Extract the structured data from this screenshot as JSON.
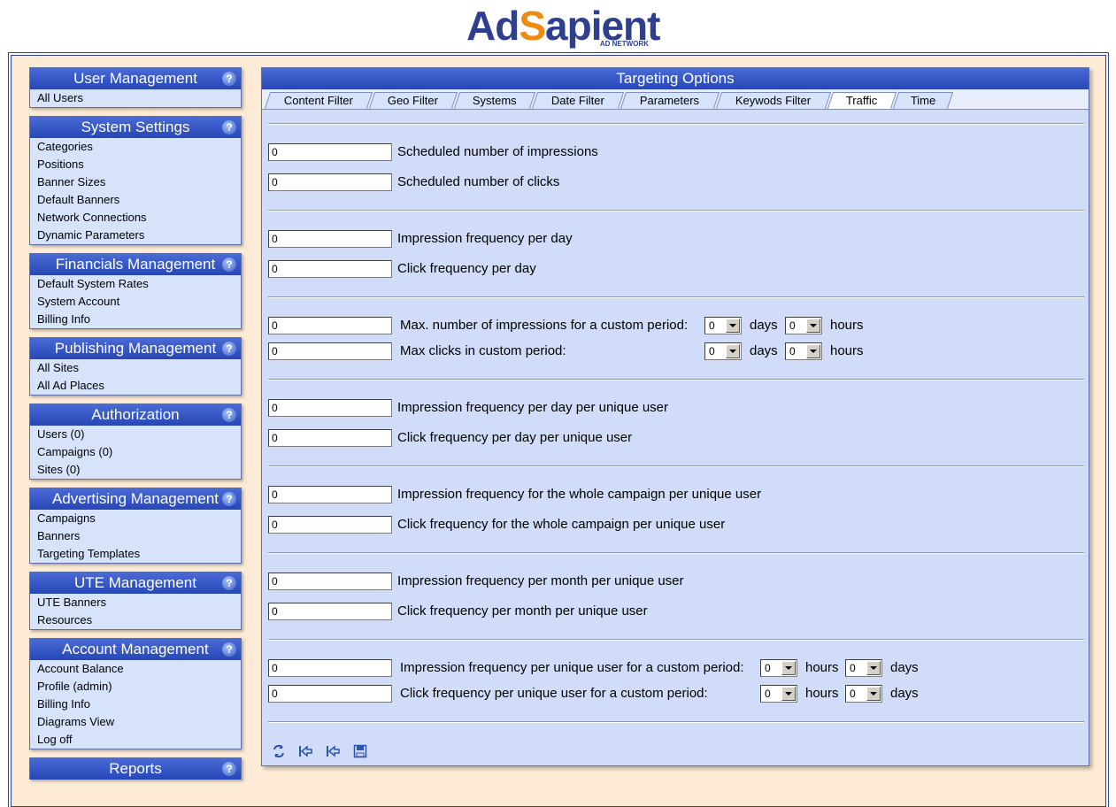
{
  "logo": {
    "part1": "Ad",
    "part2": "S",
    "part3": "apient",
    "tagline": "AD NETWORK"
  },
  "sidebar": {
    "sections": [
      {
        "title": "User Management",
        "items": [
          "All Users"
        ]
      },
      {
        "title": "System Settings",
        "items": [
          "Categories",
          "Positions",
          "Banner Sizes",
          "Default Banners",
          "Network Connections",
          "Dynamic Parameters"
        ]
      },
      {
        "title": "Financials Management",
        "items": [
          "Default System Rates",
          "System Account",
          "Billing Info"
        ]
      },
      {
        "title": "Publishing Management",
        "items": [
          "All Sites",
          "All Ad Places"
        ]
      },
      {
        "title": "Authorization",
        "items": [
          "Users (0)",
          "Campaigns (0)",
          "Sites (0)"
        ]
      },
      {
        "title": "Advertising Management",
        "items": [
          "Campaigns",
          "Banners",
          "Targeting Templates"
        ]
      },
      {
        "title": "UTE Management",
        "items": [
          "UTE Banners",
          "Resources"
        ]
      },
      {
        "title": "Account Management",
        "items": [
          "Account Balance",
          "Profile (admin)",
          "Billing Info",
          "Diagrams View",
          "Log off"
        ]
      },
      {
        "title": "Reports",
        "items": []
      }
    ],
    "help_glyph": "?"
  },
  "main": {
    "title": "Targeting Options",
    "tabs": [
      "Content Filter",
      "Geo Filter",
      "Systems",
      "Date Filter",
      "Parameters",
      "Keywods Filter",
      "Traffic",
      "Time"
    ],
    "active_tab": "Traffic",
    "fields": {
      "sched_impr": {
        "value": "0",
        "label": "Scheduled number of impressions"
      },
      "sched_clicks": {
        "value": "0",
        "label": "Scheduled number of clicks"
      },
      "impr_day": {
        "value": "0",
        "label": "Impression frequency per day"
      },
      "click_day": {
        "value": "0",
        "label": "Click frequency per day"
      },
      "max_impr_custom": {
        "value": "0",
        "label": "Max. number of impressions for a custom period:",
        "sel1": "0",
        "unit1": "days",
        "sel2": "0",
        "unit2": "hours"
      },
      "max_clicks_custom": {
        "value": "0",
        "label": "Max clicks in custom period:",
        "sel1": "0",
        "unit1": "days",
        "sel2": "0",
        "unit2": "hours"
      },
      "impr_day_user": {
        "value": "0",
        "label": "Impression frequency per day per unique user"
      },
      "click_day_user": {
        "value": "0",
        "label": "Click frequency per day per unique user"
      },
      "impr_campaign_user": {
        "value": "0",
        "label": "Impression frequency for the whole campaign per unique user"
      },
      "click_campaign_user": {
        "value": "0",
        "label": "Click frequency for the whole campaign per unique user"
      },
      "impr_month_user": {
        "value": "0",
        "label": "Impression frequency per month per unique user"
      },
      "click_month_user": {
        "value": "0",
        "label": "Click frequency per month per unique user"
      },
      "impr_user_custom": {
        "value": "0",
        "label": "Impression frequency per unique user for a custom period:",
        "sel1": "0",
        "unit1": "hours",
        "sel2": "0",
        "unit2": "days"
      },
      "click_user_custom": {
        "value": "0",
        "label": "Click frequency per unique user for a custom period:",
        "sel1": "0",
        "unit1": "hours",
        "sel2": "0",
        "unit2": "days"
      }
    },
    "toolbar_icons": [
      "refresh-icon",
      "first-page-icon",
      "previous-page-icon",
      "save-icon"
    ]
  }
}
